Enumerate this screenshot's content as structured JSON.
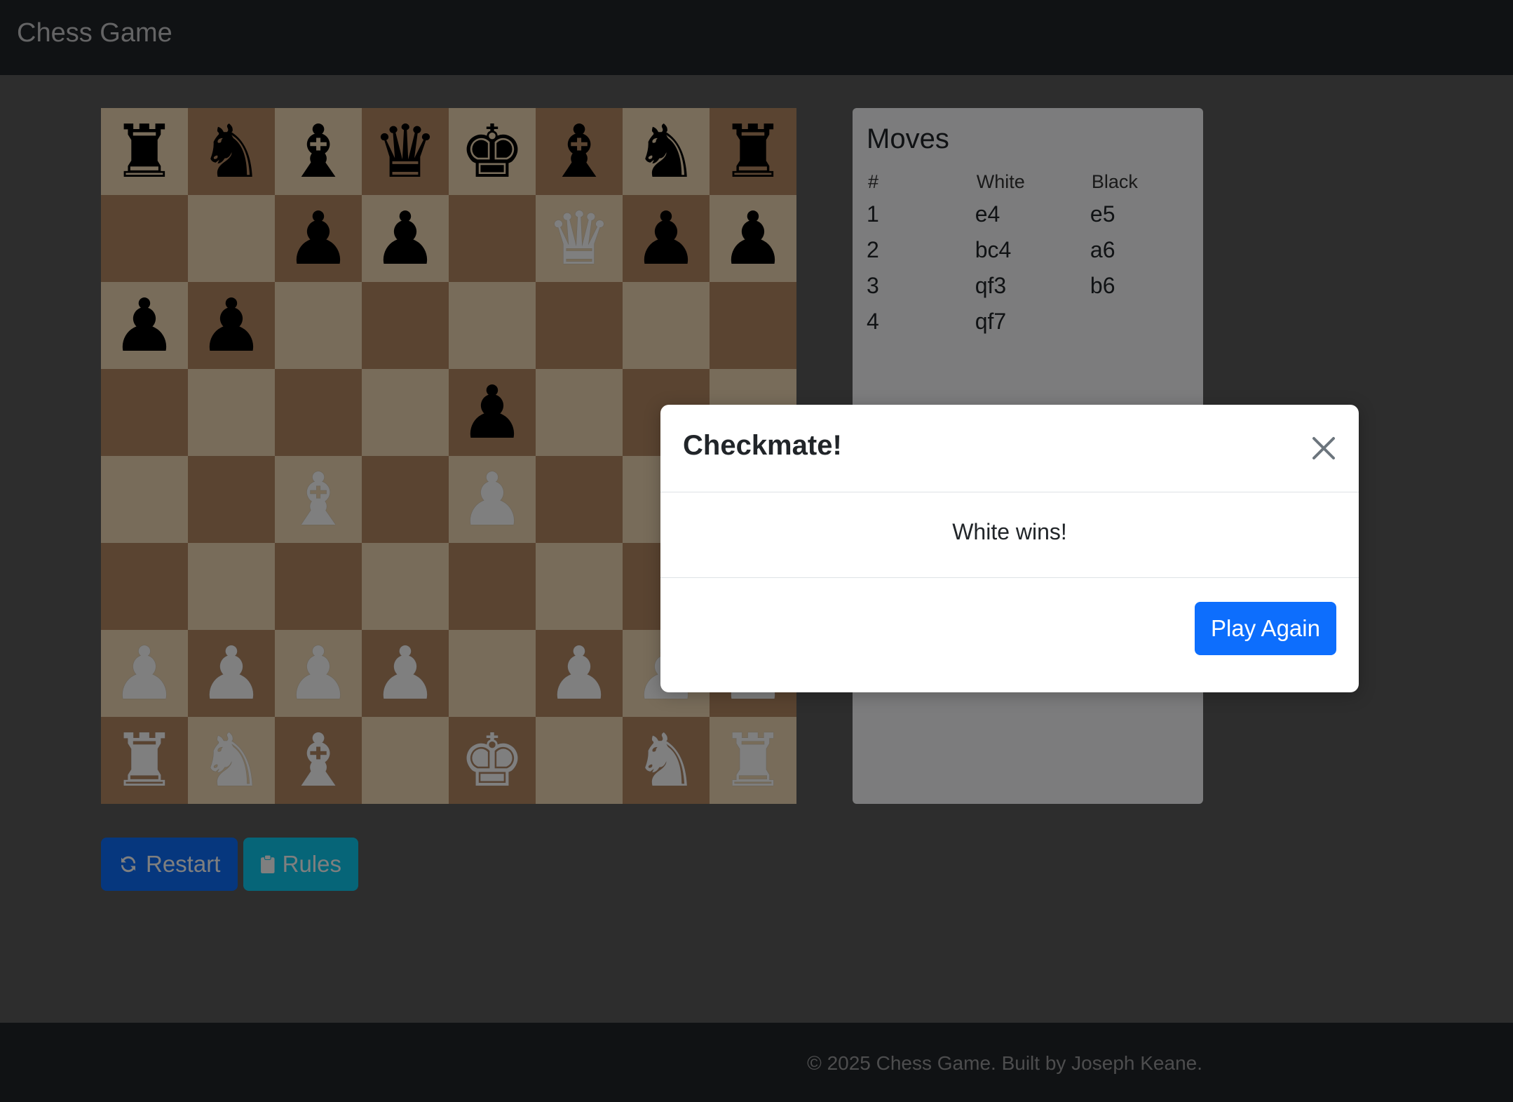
{
  "navbar": {
    "brand": "Chess Game"
  },
  "board": {
    "rows": [
      [
        "bR",
        "bN",
        "bB",
        "bQ",
        "bK",
        "bB",
        "bN",
        "bR"
      ],
      [
        "",
        "",
        "bP",
        "bP",
        "",
        "wQ",
        "bP",
        "bP"
      ],
      [
        "bP",
        "bP",
        "",
        "",
        "",
        "",
        "",
        ""
      ],
      [
        "",
        "",
        "",
        "",
        "bP",
        "",
        "",
        ""
      ],
      [
        "",
        "",
        "wB",
        "",
        "wP",
        "",
        "",
        ""
      ],
      [
        "",
        "",
        "",
        "",
        "",
        "",
        "",
        ""
      ],
      [
        "wP",
        "wP",
        "wP",
        "wP",
        "",
        "wP",
        "wP",
        "wP"
      ],
      [
        "wR",
        "wN",
        "wB",
        "",
        "wK",
        "",
        "wN",
        "wR"
      ]
    ]
  },
  "glyphs": {
    "K": "♚",
    "Q": "♛",
    "R": "♜",
    "B": "♝",
    "N": "♞",
    "P": "♟"
  },
  "moves_panel": {
    "title": "Moves",
    "headers": [
      "#",
      "White",
      "Black"
    ],
    "rows": [
      [
        "1",
        "e4",
        "e5"
      ],
      [
        "2",
        "bc4",
        "a6"
      ],
      [
        "3",
        "qf3",
        "b6"
      ],
      [
        "4",
        "qf7",
        ""
      ]
    ]
  },
  "buttons": {
    "restart": "Restart",
    "rules": "Rules"
  },
  "footer": {
    "text": "© 2025 Chess Game. Built by Joseph Keane."
  },
  "modal": {
    "title": "Checkmate!",
    "message": "White wins!",
    "play_again": "Play Again"
  },
  "colors": {
    "light_square": "#f0d9b5",
    "dark_square": "#b58863",
    "primary": "#0d6efd",
    "info": "#0dcaf0"
  }
}
